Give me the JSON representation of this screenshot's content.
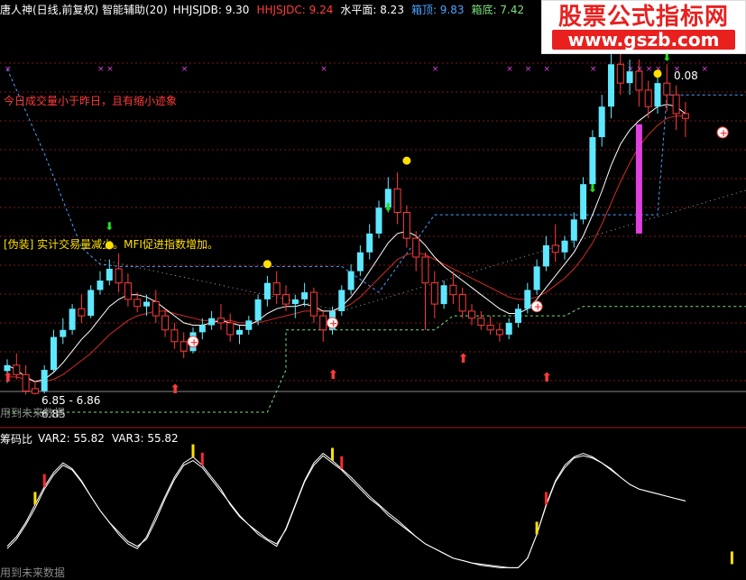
{
  "header": {
    "name": "唐人神(日线,前复权) 智能辅助(20)",
    "values": [
      {
        "label": "HHJSJDB: 9.30",
        "color": "#ffffff"
      },
      {
        "label": "HHJSJDC: 9.24",
        "color": "#ff3b3b"
      },
      {
        "label": "水平面: 8.23",
        "color": "#ffffff"
      },
      {
        "label": "箱顶: 9.83",
        "color": "#4da3ff"
      },
      {
        "label": "箱底: 7.42",
        "color": "#7be07b"
      }
    ]
  },
  "watermark": {
    "title": "股票公式指标网",
    "url": "www.gszb.com"
  },
  "annotations": {
    "red_note": "今日成交量小于昨日，且有缩小迹象",
    "yellow_note": "[伪装] 实计交易量减少。MFI促进指数增加。",
    "peak_label": "0.08",
    "low_range": "6.85 - 6.86",
    "low_label": "6.85",
    "watermark_text_1": "用到未来数据",
    "watermark_text_2": "用到未来数据"
  },
  "lower_header": {
    "name": "筹码比",
    "values": [
      {
        "label": "VAR2: 55.82",
        "color": "#ffffff"
      },
      {
        "label": "VAR3: 55.82",
        "color": "#ffffff"
      }
    ]
  },
  "colors": {
    "up": "#5ee8ff",
    "down": "#ff3b3b",
    "ma_white": "#ffffff",
    "ma_red": "#d42a2a",
    "box_top": "#4da3ff",
    "box_bottom": "#7be07b",
    "magenta": "#e040e0",
    "yellow": "#ffe000"
  },
  "chart_data": {
    "type": "candlestick",
    "ylim": [
      6.6,
      9.9
    ],
    "candles": [
      [
        7.05,
        7.15,
        7.1,
        6.95
      ],
      [
        7.1,
        7.2,
        7.02,
        6.98
      ],
      [
        7.02,
        7.1,
        6.88,
        6.85
      ],
      [
        6.9,
        6.96,
        6.86,
        6.85
      ],
      [
        6.88,
        7.1,
        7.06,
        6.86
      ],
      [
        7.06,
        7.4,
        7.34,
        7.04
      ],
      [
        7.34,
        7.5,
        7.4,
        7.28
      ],
      [
        7.4,
        7.62,
        7.58,
        7.36
      ],
      [
        7.58,
        7.7,
        7.52,
        7.46
      ],
      [
        7.52,
        7.78,
        7.74,
        7.5
      ],
      [
        7.74,
        7.9,
        7.82,
        7.7
      ],
      [
        7.82,
        8.0,
        7.92,
        7.78
      ],
      [
        7.92,
        8.05,
        7.8,
        7.72
      ],
      [
        7.8,
        7.88,
        7.66,
        7.6
      ],
      [
        7.66,
        7.72,
        7.6,
        7.55
      ],
      [
        7.6,
        7.7,
        7.64,
        7.52
      ],
      [
        7.64,
        7.74,
        7.52,
        7.46
      ],
      [
        7.52,
        7.58,
        7.4,
        7.34
      ],
      [
        7.4,
        7.46,
        7.3,
        7.24
      ],
      [
        7.3,
        7.38,
        7.22,
        7.16
      ],
      [
        7.22,
        7.42,
        7.38,
        7.2
      ],
      [
        7.38,
        7.5,
        7.44,
        7.32
      ],
      [
        7.44,
        7.56,
        7.5,
        7.4
      ],
      [
        7.5,
        7.62,
        7.46,
        7.4
      ],
      [
        7.46,
        7.54,
        7.36,
        7.3
      ],
      [
        7.36,
        7.44,
        7.4,
        7.28
      ],
      [
        7.4,
        7.52,
        7.48,
        7.36
      ],
      [
        7.48,
        7.7,
        7.66,
        7.44
      ],
      [
        7.66,
        7.86,
        7.8,
        7.6
      ],
      [
        7.8,
        7.9,
        7.7,
        7.62
      ],
      [
        7.7,
        7.78,
        7.62,
        7.56
      ],
      [
        7.62,
        7.7,
        7.66,
        7.5
      ],
      [
        7.66,
        7.8,
        7.72,
        7.6
      ],
      [
        7.72,
        7.76,
        7.52,
        7.46
      ],
      [
        7.52,
        7.56,
        7.4,
        7.3
      ],
      [
        7.4,
        7.6,
        7.56,
        7.36
      ],
      [
        7.56,
        7.78,
        7.74,
        7.52
      ],
      [
        7.74,
        7.96,
        7.9,
        7.7
      ],
      [
        7.9,
        8.12,
        8.06,
        7.86
      ],
      [
        8.06,
        8.3,
        8.22,
        8.0
      ],
      [
        8.22,
        8.5,
        8.44,
        8.18
      ],
      [
        8.44,
        8.7,
        8.6,
        8.4
      ],
      [
        8.6,
        8.74,
        8.4,
        8.3
      ],
      [
        8.4,
        8.46,
        8.18,
        8.1
      ],
      [
        8.18,
        8.24,
        8.02,
        7.9
      ],
      [
        8.02,
        8.06,
        7.8,
        7.4
      ],
      [
        7.8,
        7.9,
        7.62,
        7.5
      ],
      [
        7.62,
        7.82,
        7.78,
        7.58
      ],
      [
        7.78,
        7.9,
        7.7,
        7.62
      ],
      [
        7.7,
        7.76,
        7.56,
        7.5
      ],
      [
        7.56,
        7.62,
        7.5,
        7.44
      ],
      [
        7.5,
        7.56,
        7.44,
        7.4
      ],
      [
        7.44,
        7.52,
        7.4,
        7.36
      ],
      [
        7.4,
        7.46,
        7.36,
        7.3
      ],
      [
        7.36,
        7.5,
        7.46,
        7.32
      ],
      [
        7.46,
        7.62,
        7.58,
        7.42
      ],
      [
        7.58,
        7.8,
        7.74,
        7.54
      ],
      [
        7.74,
        8.0,
        7.94,
        7.7
      ],
      [
        7.94,
        8.2,
        8.12,
        7.9
      ],
      [
        8.12,
        8.3,
        8.06,
        7.98
      ],
      [
        8.06,
        8.2,
        8.16,
        8.0
      ],
      [
        8.16,
        8.4,
        8.34,
        8.1
      ],
      [
        8.34,
        8.7,
        8.64,
        8.3
      ],
      [
        8.64,
        9.1,
        9.04,
        8.6
      ],
      [
        9.04,
        9.4,
        9.3,
        8.96
      ],
      [
        9.3,
        9.8,
        9.66,
        9.2
      ],
      [
        9.66,
        9.86,
        9.5,
        9.4
      ],
      [
        9.5,
        9.7,
        9.6,
        9.4
      ],
      [
        9.6,
        9.7,
        9.44,
        9.3
      ],
      [
        9.44,
        9.52,
        9.3,
        9.2
      ],
      [
        9.3,
        9.56,
        9.5,
        9.24
      ],
      [
        9.5,
        9.66,
        9.4,
        9.26
      ],
      [
        9.4,
        9.48,
        9.24,
        9.1
      ],
      [
        9.24,
        9.34,
        9.2,
        9.04
      ]
    ],
    "ma_white": [
      7.1,
      7.06,
      7.0,
      6.96,
      6.98,
      7.04,
      7.12,
      7.22,
      7.32,
      7.4,
      7.5,
      7.6,
      7.66,
      7.7,
      7.7,
      7.68,
      7.64,
      7.58,
      7.52,
      7.46,
      7.44,
      7.44,
      7.46,
      7.48,
      7.46,
      7.44,
      7.44,
      7.48,
      7.54,
      7.58,
      7.6,
      7.6,
      7.62,
      7.6,
      7.56,
      7.56,
      7.6,
      7.68,
      7.78,
      7.9,
      8.02,
      8.14,
      8.22,
      8.24,
      8.2,
      8.12,
      8.02,
      7.94,
      7.88,
      7.82,
      7.76,
      7.7,
      7.64,
      7.58,
      7.54,
      7.54,
      7.58,
      7.66,
      7.76,
      7.86,
      7.96,
      8.06,
      8.2,
      8.38,
      8.58,
      8.8,
      8.98,
      9.1,
      9.18,
      9.24,
      9.3,
      9.32,
      9.3,
      9.24
    ],
    "ma_red": [
      7.0,
      7.0,
      6.98,
      6.96,
      6.96,
      6.98,
      7.02,
      7.08,
      7.14,
      7.2,
      7.28,
      7.36,
      7.42,
      7.48,
      7.52,
      7.54,
      7.56,
      7.56,
      7.54,
      7.52,
      7.5,
      7.48,
      7.48,
      7.48,
      7.48,
      7.46,
      7.46,
      7.46,
      7.48,
      7.5,
      7.52,
      7.54,
      7.56,
      7.56,
      7.56,
      7.56,
      7.58,
      7.62,
      7.68,
      7.76,
      7.84,
      7.92,
      8.0,
      8.04,
      8.06,
      8.04,
      8.0,
      7.96,
      7.92,
      7.88,
      7.84,
      7.8,
      7.76,
      7.72,
      7.68,
      7.66,
      7.66,
      7.68,
      7.72,
      7.78,
      7.84,
      7.92,
      8.02,
      8.14,
      8.3,
      8.48,
      8.66,
      8.82,
      8.96,
      9.06,
      9.14,
      9.2,
      9.22,
      9.22
    ],
    "box_top": [
      [
        0,
        9.62
      ],
      [
        4,
        8.9
      ],
      [
        8,
        8.1
      ],
      [
        10,
        7.96
      ],
      [
        12,
        7.94
      ],
      [
        24,
        7.94
      ],
      [
        36,
        7.94
      ],
      [
        40,
        7.72
      ],
      [
        46,
        8.38
      ],
      [
        70,
        8.38
      ],
      [
        71,
        9.4
      ],
      [
        80,
        9.4
      ]
    ],
    "box_bottom": [
      [
        0,
        6.7
      ],
      [
        28,
        6.7
      ],
      [
        30,
        7.06
      ],
      [
        30,
        7.4
      ],
      [
        46,
        7.4
      ],
      [
        48,
        7.52
      ],
      [
        60,
        7.52
      ],
      [
        62,
        7.6
      ],
      [
        80,
        7.6
      ]
    ],
    "dots_up": [
      [
        10,
        7.6
      ],
      [
        22,
        7.62
      ],
      [
        34,
        7.58
      ],
      [
        44,
        7.8
      ],
      [
        58,
        7.7
      ],
      [
        72,
        8.16
      ],
      [
        80,
        8.6
      ]
    ],
    "lower": {
      "type": "line",
      "var2": [
        20,
        28,
        40,
        55,
        70,
        82,
        90,
        85,
        75,
        62,
        50,
        40,
        30,
        22,
        18,
        28,
        45,
        62,
        78,
        90,
        95,
        88,
        78,
        68,
        55,
        45,
        38,
        30,
        25,
        20,
        35,
        55,
        75,
        90,
        98,
        92,
        85,
        78,
        70,
        62,
        55,
        48,
        42,
        35,
        28,
        22,
        18,
        14,
        10,
        8,
        6,
        5,
        4,
        3,
        2,
        2,
        10,
        30,
        55,
        75,
        88,
        95,
        98,
        95,
        90,
        85,
        78,
        72,
        68,
        66,
        64,
        62,
        60,
        58
      ],
      "var3": [
        18,
        26,
        38,
        52,
        68,
        80,
        88,
        84,
        74,
        62,
        50,
        40,
        32,
        24,
        20,
        26,
        42,
        60,
        76,
        88,
        92,
        86,
        76,
        66,
        56,
        46,
        38,
        32,
        26,
        22,
        34,
        54,
        74,
        88,
        96,
        90,
        84,
        76,
        68,
        60,
        54,
        46,
        40,
        34,
        28,
        22,
        18,
        14,
        10,
        8,
        6,
        4,
        3,
        2,
        2,
        2,
        10,
        30,
        54,
        74,
        86,
        94,
        96,
        94,
        90,
        84,
        78,
        72,
        68,
        66,
        64,
        62,
        60,
        58
      ]
    }
  }
}
